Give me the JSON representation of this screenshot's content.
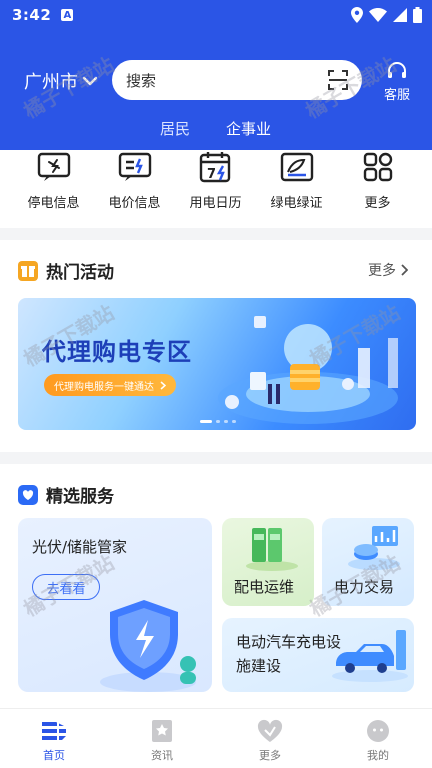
{
  "status": {
    "time": "3:42",
    "app_icon_letter": "A"
  },
  "header": {
    "city": "广州市",
    "search_placeholder": "搜索",
    "service_label": "客服",
    "segments": {
      "resident": "居民",
      "enterprise": "企事业"
    }
  },
  "quick": [
    {
      "label": "停电信息",
      "icon": "power-outage-icon"
    },
    {
      "label": "电价信息",
      "icon": "price-icon"
    },
    {
      "label": "用电日历",
      "icon": "calendar-icon",
      "day": "7"
    },
    {
      "label": "绿电绿证",
      "icon": "certificate-icon"
    },
    {
      "label": "更多",
      "icon": "grid-icon"
    }
  ],
  "hot": {
    "title": "热门活动",
    "more": "更多",
    "banner_title": "代理购电专区",
    "banner_button": "代理购电服务一键通达"
  },
  "featured": {
    "title": "精选服务",
    "big_card": {
      "title": "光伏/储能管家",
      "button": "去看看"
    },
    "cards": [
      "配电运维",
      "电力交易",
      "电动汽车充电设施建设"
    ]
  },
  "tabs": [
    {
      "label": "首页",
      "active": true
    },
    {
      "label": "资讯",
      "active": false
    },
    {
      "label": "更多",
      "active": false
    },
    {
      "label": "我的",
      "active": false
    }
  ],
  "watermark": "橘子下载站",
  "colors": {
    "brand": "#2b55e6",
    "accent": "#f5a623"
  }
}
